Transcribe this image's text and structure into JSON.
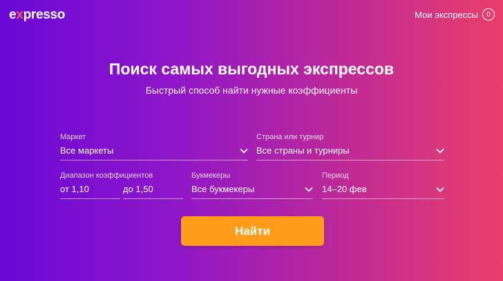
{
  "header": {
    "logo_prefix": "e",
    "logo_accent": "x",
    "logo_suffix": "presso",
    "my_expresses_label": "Мои экспрессы",
    "my_expresses_count": "0"
  },
  "hero": {
    "title": "Поиск самых выгодных экспрессов",
    "subtitle": "Быстрый способ найти нужные коэффициенты"
  },
  "filters": {
    "market": {
      "label": "Маркет",
      "value": "Все маркеты"
    },
    "country": {
      "label": "Страна или турнир",
      "value": "Все страны и турниры"
    },
    "odds_range": {
      "label": "Диапазон коэффициентов",
      "from": "от 1,10",
      "to": "до 1,50"
    },
    "bookmakers": {
      "label": "Букмекеры",
      "value": "Все букмекеры"
    },
    "period": {
      "label": "Период",
      "value": "14–20 фев"
    }
  },
  "search_button_label": "Найти"
}
